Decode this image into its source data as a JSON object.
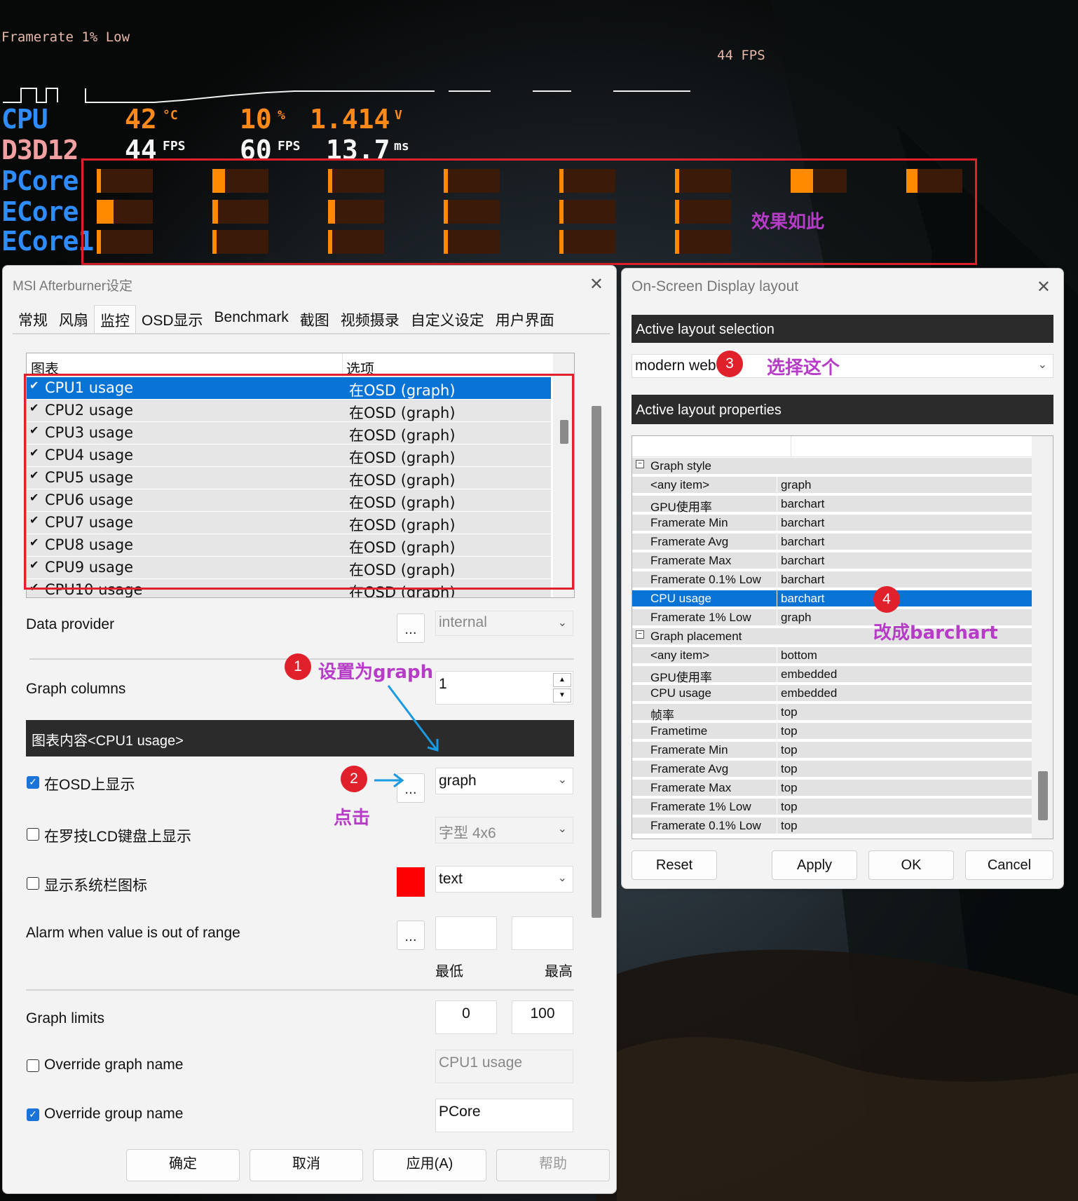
{
  "osd": {
    "framerate_1pct_low_label": "Framerate 1% Low",
    "fps_label_top": "44 FPS",
    "cpu_label": "CPU",
    "cpu_temp": "42",
    "cpu_temp_unit": "°C",
    "cpu_usage": "10",
    "cpu_usage_unit": "%",
    "cpu_voltage": "1.414",
    "cpu_voltage_unit": "V",
    "d3d_label": "D3D12",
    "d3d_fps": "44",
    "d3d_fps_unit": "FPS",
    "d3d_fps2": "60",
    "d3d_fps2_unit": "FPS",
    "d3d_frametime": "13.7",
    "d3d_frametime_unit": "ms",
    "group_labels": [
      "PCore",
      "ECore",
      "ECore1"
    ],
    "pcore_levels": [
      0.08,
      0.22,
      0.0,
      0.02,
      0.0,
      0.02,
      0.4,
      0.2
    ],
    "ecore_levels": [
      0.3,
      0.1,
      0.12,
      0.08,
      0.04,
      0.02
    ],
    "ecore1_levels": [
      0.02,
      0.01,
      0.01,
      0.02,
      0.06,
      0.04
    ],
    "colors": {
      "bar_fill": "#ff8a00",
      "bar_bg": "#3b1a0a",
      "group_label": "#2e8cff",
      "accent_orange": "#ff8a1a"
    }
  },
  "annotations": {
    "effect": "效果如此",
    "badge1": "1",
    "set_graph": "设置为graph",
    "badge2": "2",
    "click": "点击",
    "badge3": "3",
    "choose_this": "选择这个",
    "badge4": "4",
    "change_barchart": "改成barchart"
  },
  "msi": {
    "title": "MSI Afterburner设定",
    "tabs": [
      "常规",
      "风扇",
      "监控",
      "OSD显示",
      "Benchmark",
      "截图",
      "视频摄录",
      "自定义设定",
      "用户界面"
    ],
    "active_tab": 2,
    "list_header": {
      "col1": "图表",
      "col2": "选项"
    },
    "list_rows": [
      {
        "name": "CPU1 usage",
        "opt": "在OSD (graph)"
      },
      {
        "name": "CPU2 usage",
        "opt": "在OSD (graph)"
      },
      {
        "name": "CPU3 usage",
        "opt": "在OSD (graph)"
      },
      {
        "name": "CPU4 usage",
        "opt": "在OSD (graph)"
      },
      {
        "name": "CPU5 usage",
        "opt": "在OSD (graph)"
      },
      {
        "name": "CPU6 usage",
        "opt": "在OSD (graph)"
      },
      {
        "name": "CPU7 usage",
        "opt": "在OSD (graph)"
      },
      {
        "name": "CPU8 usage",
        "opt": "在OSD (graph)"
      },
      {
        "name": "CPU9 usage",
        "opt": "在OSD (graph)"
      },
      {
        "name": "CPU10 usage",
        "opt": "在OSD (graph)"
      }
    ],
    "data_provider_label": "Data provider",
    "data_provider_value": "internal",
    "graph_columns_label": "Graph columns",
    "graph_columns_value": "1",
    "section_title": "图表内容<CPU1 usage>",
    "show_osd_label": "在OSD上显示",
    "show_osd_value": "graph",
    "show_lcd_label": "在罗技LCD键盘上显示",
    "lcd_value": "字型 4x6",
    "tray_label": "显示系统栏图标",
    "tray_value": "text",
    "tray_color": "#ff0000",
    "alarm_label": "Alarm when value is out of range",
    "min_label": "最低",
    "max_label": "最高",
    "graph_limits_label": "Graph limits",
    "graph_limit_min": "0",
    "graph_limit_max": "100",
    "override_graph_label": "Override graph name",
    "override_graph_placeholder": "CPU1 usage",
    "override_group_label": "Override group name",
    "override_group_value": "PCore",
    "btn_ok": "确定",
    "btn_cancel": "取消",
    "btn_apply": "应用(A)",
    "btn_help": "帮助",
    "dots": "..."
  },
  "osd_layout": {
    "title": "On-Screen Display layout",
    "active_selection_header": "Active layout selection",
    "layout_value": "modern web",
    "active_properties_header": "Active layout properties",
    "graph_style_group": "Graph style",
    "graph_style_rows": [
      {
        "k": "<any item>",
        "v": "graph"
      },
      {
        "k": "GPU使用率",
        "v": "barchart"
      },
      {
        "k": "Framerate Min",
        "v": "barchart"
      },
      {
        "k": "Framerate Avg",
        "v": "barchart"
      },
      {
        "k": "Framerate Max",
        "v": "barchart"
      },
      {
        "k": "Framerate 0.1% Low",
        "v": "barchart"
      },
      {
        "k": "CPU usage",
        "v": "barchart"
      },
      {
        "k": "Framerate 1% Low",
        "v": "graph"
      }
    ],
    "graph_placement_group": "Graph placement",
    "graph_placement_rows": [
      {
        "k": "<any item>",
        "v": "bottom"
      },
      {
        "k": "GPU使用率",
        "v": "embedded"
      },
      {
        "k": "CPU usage",
        "v": "embedded"
      },
      {
        "k": "帧率",
        "v": "top"
      },
      {
        "k": "Frametime",
        "v": "top"
      },
      {
        "k": "Framerate Min",
        "v": "top"
      },
      {
        "k": "Framerate Avg",
        "v": "top"
      },
      {
        "k": "Framerate Max",
        "v": "top"
      },
      {
        "k": "Framerate 1% Low",
        "v": "top"
      },
      {
        "k": "Framerate 0.1% Low",
        "v": "top"
      }
    ],
    "btn_reset": "Reset",
    "btn_apply": "Apply",
    "btn_ok": "OK",
    "btn_cancel": "Cancel"
  }
}
